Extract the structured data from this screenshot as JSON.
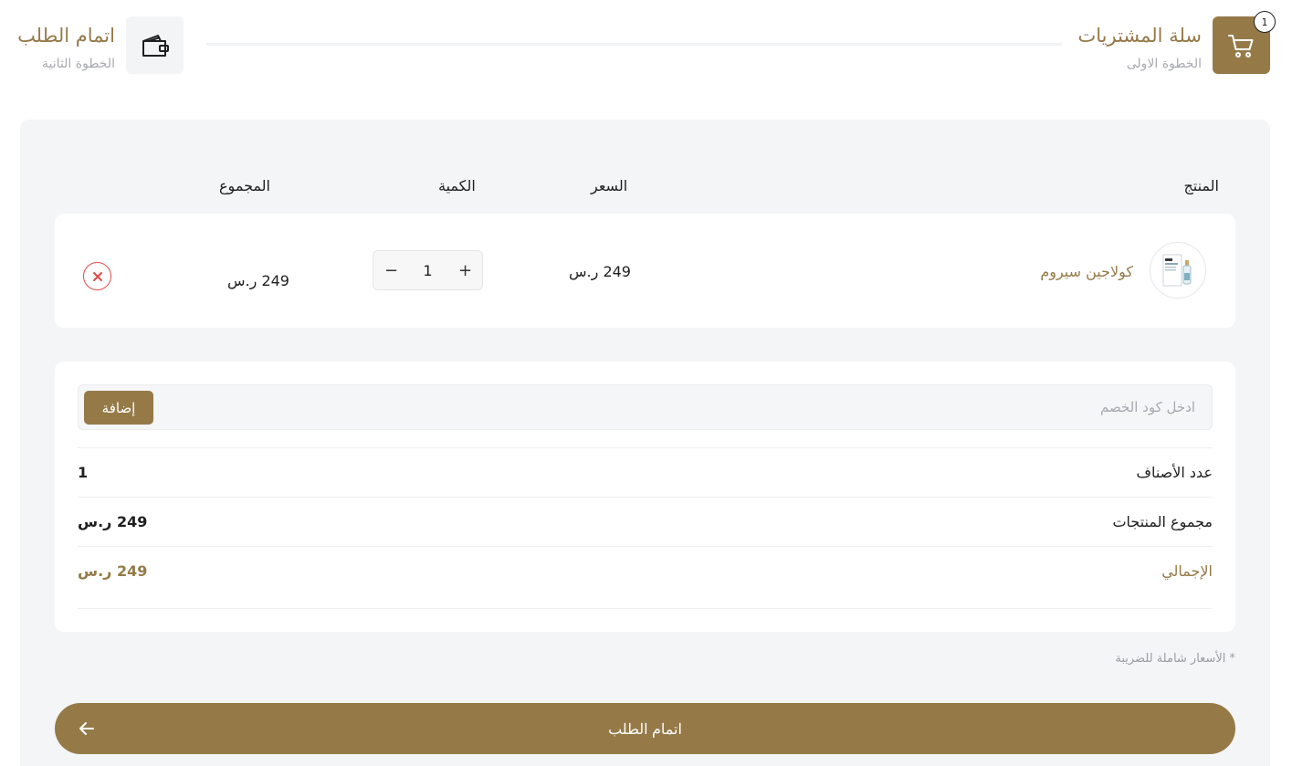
{
  "steps": {
    "first": {
      "title": "سلة المشتريات",
      "subtitle": "الخطوة الاولى",
      "badge": "1",
      "icon": "cart-icon"
    },
    "second": {
      "title": "اتمام الطلب",
      "subtitle": "الخطوة الثانية",
      "icon": "wallet-icon"
    }
  },
  "table": {
    "headers": {
      "product": "المنتج",
      "price": "السعر",
      "quantity": "الكمية",
      "total": "المجموع"
    },
    "item": {
      "name": "كولاجين سيروم",
      "price": "249 ر.س",
      "quantity": "1",
      "total": "249 ر.س"
    }
  },
  "coupon": {
    "placeholder": "ادخل كود الخصم",
    "button": "إضافة"
  },
  "summary": {
    "items_count_label": "عدد الأصناف",
    "items_count_value": "1",
    "subtotal_label": "مجموع المنتجات",
    "subtotal_value": "249 ر.س",
    "total_label": "الإجمالي",
    "total_value": "249 ر.س"
  },
  "tax_note": "* الأسعار شاملة للضريبة",
  "checkout_button": "اتمام الطلب",
  "colors": {
    "accent": "#957a48",
    "danger": "#e24a4a",
    "panel": "#f4f5f7"
  }
}
